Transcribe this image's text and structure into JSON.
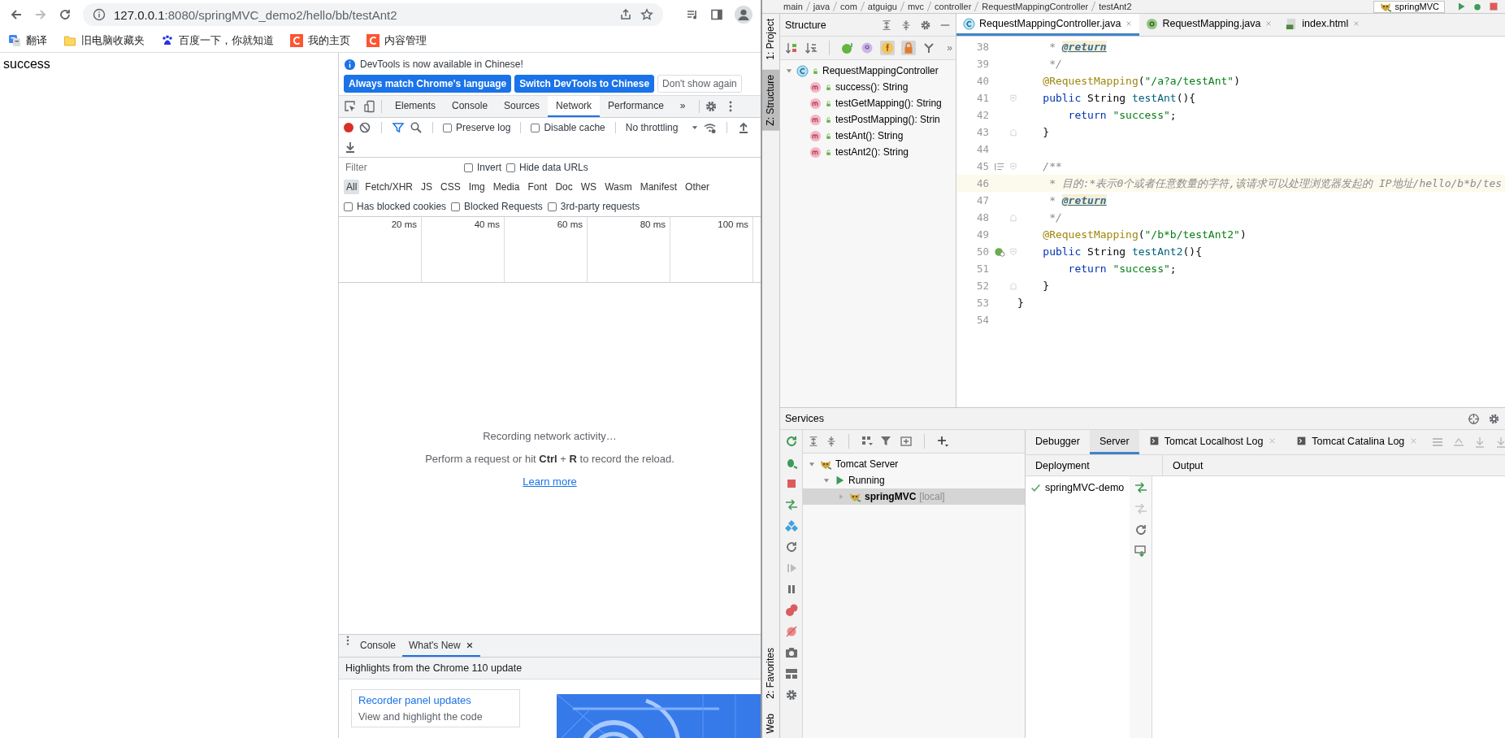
{
  "browser": {
    "address": {
      "host": "127.0.0.1",
      "path": ":8080/springMVC_demo2/hello/bb/testAnt2"
    },
    "bookmarks": [
      {
        "label": "翻译",
        "kind": "translate"
      },
      {
        "label": "旧电脑收藏夹",
        "kind": "folder"
      },
      {
        "label": "百度一下，你就知道",
        "kind": "paw"
      },
      {
        "label": "我的主页",
        "kind": "c-logo"
      },
      {
        "label": "内容管理",
        "kind": "c-logo"
      }
    ],
    "page_text": "success"
  },
  "devtools": {
    "infobar": {
      "message": "DevTools is now available in Chinese!",
      "buttons": [
        {
          "label": "Always match Chrome's language",
          "primary": true
        },
        {
          "label": "Switch DevTools to Chinese",
          "primary": true
        },
        {
          "label": "Don't show again",
          "primary": false
        }
      ]
    },
    "tabs": [
      {
        "label": "Elements",
        "selected": false
      },
      {
        "label": "Console",
        "selected": false
      },
      {
        "label": "Sources",
        "selected": false
      },
      {
        "label": "Network",
        "selected": true
      },
      {
        "label": "Performance",
        "selected": false
      }
    ],
    "more_tabs": "»",
    "toolbar": {
      "recording": true,
      "options": [
        {
          "label": "Preserve log",
          "checked": false
        },
        {
          "label": "Disable cache",
          "checked": false
        }
      ],
      "throttling": "No throttling"
    },
    "filter": {
      "placeholder": "Filter",
      "options": [
        {
          "label": "Invert",
          "checked": false
        },
        {
          "label": "Hide data URLs",
          "checked": false
        }
      ]
    },
    "types": [
      {
        "label": "All",
        "selected": true
      },
      {
        "label": "Fetch/XHR",
        "selected": false
      },
      {
        "label": "JS",
        "selected": false
      },
      {
        "label": "CSS",
        "selected": false
      },
      {
        "label": "Img",
        "selected": false
      },
      {
        "label": "Media",
        "selected": false
      },
      {
        "label": "Font",
        "selected": false
      },
      {
        "label": "Doc",
        "selected": false
      },
      {
        "label": "WS",
        "selected": false
      },
      {
        "label": "Wasm",
        "selected": false
      },
      {
        "label": "Manifest",
        "selected": false
      },
      {
        "label": "Other",
        "selected": false
      }
    ],
    "request_filters": [
      {
        "label": "Has blocked cookies",
        "checked": false
      },
      {
        "label": "Blocked Requests",
        "checked": false
      },
      {
        "label": "3rd-party requests",
        "checked": false
      }
    ],
    "timeline_ticks": [
      "20 ms",
      "40 ms",
      "60 ms",
      "80 ms",
      "100 ms"
    ],
    "empty": {
      "title": "Recording network activity…",
      "hint": "Perform a request or hit **Ctrl** + **R** to record the reload.",
      "link": "Learn more"
    },
    "drawer": {
      "tabs": [
        {
          "label": "Console",
          "selected": false,
          "closable": false
        },
        {
          "label": "What's New",
          "selected": true,
          "closable": true
        }
      ],
      "headline": "Highlights from the Chrome 110 update",
      "card": {
        "title": "Recorder panel updates",
        "text": "View and highlight the code"
      }
    }
  },
  "ide": {
    "breadcrumb": [
      "main",
      "java",
      "com",
      "atguigu",
      "mvc",
      "controller",
      "RequestMappingController",
      "testAnt2"
    ],
    "run_config": "springMVC",
    "left_stripe": {
      "top": [
        {
          "label": "1: Project",
          "selected": false
        },
        {
          "label": "Z: Structure",
          "selected": true
        }
      ],
      "bottom": [
        {
          "label": "2: Favorites",
          "selected": false
        },
        {
          "label": "Web",
          "selected": false
        }
      ]
    },
    "structure": {
      "title": "Structure",
      "more": "»",
      "tree": [
        {
          "label": "RequestMappingController",
          "kind": "class",
          "expanded": true,
          "children": [
            {
              "label": "success(): String",
              "kind": "method"
            },
            {
              "label": "testGetMapping(): String",
              "kind": "method"
            },
            {
              "label": "testPostMapping(): Strin",
              "kind": "method"
            },
            {
              "label": "testAnt(): String",
              "kind": "method"
            },
            {
              "label": "testAnt2(): String",
              "kind": "method"
            }
          ]
        }
      ]
    },
    "editor": {
      "tabs": [
        {
          "label": "RequestMappingController.java",
          "kind": "class",
          "selected": true
        },
        {
          "label": "RequestMapping.java",
          "kind": "annotation",
          "selected": false
        },
        {
          "label": "index.html",
          "kind": "html",
          "selected": false
        }
      ],
      "lines": [
        {
          "number": "38",
          "current": false,
          "segments": [
            {
              "kind": "comment",
              "text": "     * "
            },
            {
              "kind": "doctag",
              "text": "@return"
            }
          ]
        },
        {
          "number": "39",
          "current": false,
          "segments": [
            {
              "kind": "comment",
              "text": "     */"
            }
          ]
        },
        {
          "number": "40",
          "current": false,
          "segments": [
            {
              "kind": "annotation",
              "text": "    @RequestMapping"
            },
            {
              "kind": "plain",
              "text": "("
            },
            {
              "kind": "string",
              "text": "\"/a?a/testAnt\""
            },
            {
              "kind": "plain",
              "text": ")"
            }
          ]
        },
        {
          "number": "41",
          "current": false,
          "kind": "open",
          "segments": [
            {
              "kind": "keyword",
              "text": "    public "
            },
            {
              "kind": "plain",
              "text": "String "
            },
            {
              "kind": "method",
              "text": "testAnt"
            },
            {
              "kind": "plain",
              "text": "(){"
            }
          ]
        },
        {
          "number": "42",
          "current": false,
          "segments": [
            {
              "kind": "keyword",
              "text": "        return "
            },
            {
              "kind": "string",
              "text": "\"success\""
            },
            {
              "kind": "plain",
              "text": ";"
            }
          ]
        },
        {
          "number": "43",
          "current": false,
          "kind": "close",
          "segments": [
            {
              "kind": "plain",
              "text": "    }"
            }
          ]
        },
        {
          "number": "44",
          "current": false
        },
        {
          "number": "45",
          "current": false,
          "kind": "doc",
          "segments": [
            {
              "kind": "comment",
              "text": "    /**"
            }
          ]
        },
        {
          "number": "46",
          "current": true,
          "segments": [
            {
              "kind": "comment",
              "text": "     * 目的:*表示0个或者任意数量的字符,该请求可以处理浏览器发起的 IP地址/hello/b*b/tes"
            }
          ]
        },
        {
          "number": "47",
          "current": false,
          "segments": [
            {
              "kind": "comment",
              "text": "     * "
            },
            {
              "kind": "doctag",
              "text": "@return"
            }
          ]
        },
        {
          "number": "48",
          "current": false,
          "kind": "close",
          "segments": [
            {
              "kind": "comment",
              "text": "     */"
            }
          ]
        },
        {
          "number": "49",
          "current": false,
          "segments": [
            {
              "kind": "annotation",
              "text": "    @RequestMapping"
            },
            {
              "kind": "plain",
              "text": "("
            },
            {
              "kind": "string",
              "text": "\"/b*b/testAnt2\""
            },
            {
              "kind": "plain",
              "text": ")"
            }
          ]
        },
        {
          "number": "50",
          "current": false,
          "kind": "bean",
          "segments": [
            {
              "kind": "keyword",
              "text": "    public "
            },
            {
              "kind": "plain",
              "text": "String "
            },
            {
              "kind": "method",
              "text": "testAnt2"
            },
            {
              "kind": "plain",
              "text": "(){"
            }
          ]
        },
        {
          "number": "51",
          "current": false,
          "segments": [
            {
              "kind": "keyword",
              "text": "        return "
            },
            {
              "kind": "string",
              "text": "\"success\""
            },
            {
              "kind": "plain",
              "text": ";"
            }
          ]
        },
        {
          "number": "52",
          "current": false,
          "kind": "close",
          "segments": [
            {
              "kind": "plain",
              "text": "    }"
            }
          ]
        },
        {
          "number": "53",
          "current": false,
          "segments": [
            {
              "kind": "plain",
              "text": "}"
            }
          ]
        },
        {
          "number": "54",
          "current": false
        }
      ]
    },
    "services": {
      "title": "Services",
      "tree": [
        {
          "label": "Tomcat Server",
          "kind": "tomcat",
          "selected": false,
          "expanded": true,
          "children": [
            {
              "label": "Running",
              "kind": "run",
              "selected": false,
              "expanded": true,
              "children": [
                {
                  "label": "springMVC",
                  "note": "[local]",
                  "kind": "tomcat",
                  "selected": true,
                  "expanded": false
                }
              ]
            }
          ]
        }
      ],
      "tabs": [
        {
          "label": "Debugger",
          "kind": "plain",
          "selected": false
        },
        {
          "label": "Server",
          "kind": "plain",
          "selected": true
        },
        {
          "label": "Tomcat Localhost Log",
          "kind": "log",
          "selected": false
        },
        {
          "label": "Tomcat Catalina Log",
          "kind": "log",
          "selected": false
        }
      ],
      "columns": [
        "Deployment",
        "Output"
      ],
      "deployments": [
        {
          "label": "springMVC-demo",
          "deployed": true
        }
      ]
    }
  }
}
